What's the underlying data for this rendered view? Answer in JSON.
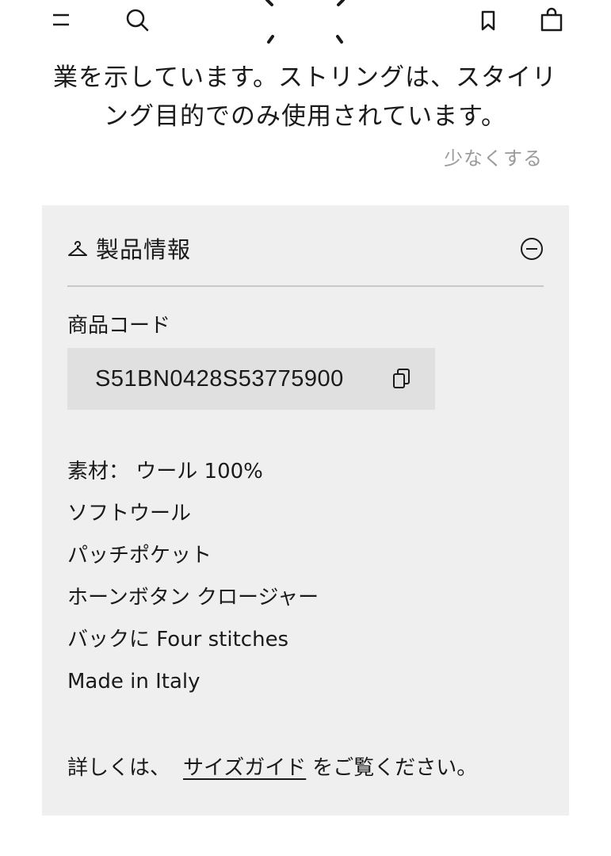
{
  "nav": {
    "menu_icon": "menu-icon",
    "search_icon": "search-icon",
    "bookmark_icon": "bookmark-icon",
    "bag_icon": "shopping-bag-icon"
  },
  "description": {
    "line1": "業を示しています。ストリングは、スタイリ",
    "line2": "ング目的でのみ使用されています。",
    "show_less_label": "少なくする"
  },
  "product_info": {
    "title": "製品情報",
    "title_icon": "hanger-icon",
    "collapse_icon": "minus-circle-icon",
    "code_label": "商品コード",
    "code_value": "S51BN0428S53775900",
    "copy_icon": "copy-icon",
    "features": [
      "素材： ウール 100%",
      "ソフトウール",
      "パッチポケット",
      "ホーンボタン クロージャー",
      "バックに Four stitches",
      "Made in Italy"
    ],
    "guide_prefix": "詳しくは、",
    "guide_link": "サイズガイド",
    "guide_suffix": "をご覧ください。"
  },
  "colors": {
    "panel_bg": "#efefef",
    "code_bg": "#e0e0e0",
    "muted_text": "#9a9a9a",
    "text": "#1a1a1a"
  }
}
